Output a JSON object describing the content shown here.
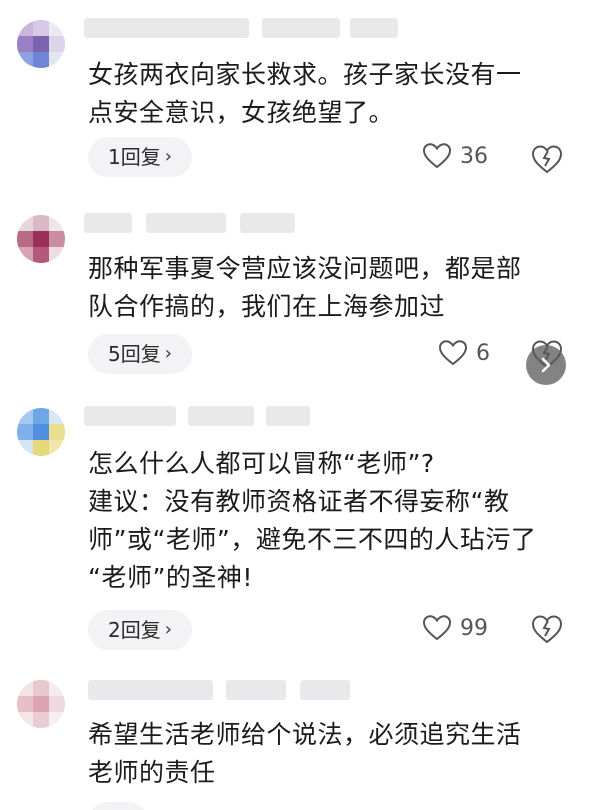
{
  "comments": [
    {
      "text": "女孩两衣向家长救求。孩子家长没有一\n点安全意识，女孩绝望了。",
      "reply_label": "1回复",
      "like_count": "36",
      "avatar_colors": [
        "#c9b6dc",
        "#d8c8e6",
        "#eceaf1",
        "#9a7fc4",
        "#7c63b0",
        "#dcd4ea",
        "#8ca2e0",
        "#6f86d6",
        "#e3e6f2"
      ]
    },
    {
      "text": "那种军事夏令营应该没问题吧，都是部\n队合作搞的，我们在上海参加过",
      "reply_label": "5回复",
      "like_count": "6",
      "avatar_colors": [
        "#e7d6dc",
        "#d9b9c4",
        "#efe6ea",
        "#b86a86",
        "#9b2f57",
        "#c98ea2",
        "#d6a4b4",
        "#b35a78",
        "#eddde3"
      ]
    },
    {
      "text": "怎么什么人都可以冒称“老师”?\n建议：没有教师资格证者不得妄称“教\n师”或“老师”，避免不三不四的人玷污了\n“老师”的圣神!",
      "reply_label": "2回复",
      "like_count": "99",
      "avatar_colors": [
        "#a9c8ef",
        "#6fa6e6",
        "#d8e6f5",
        "#7fb0ea",
        "#4f8ee0",
        "#e9de8e",
        "#d6e3f3",
        "#e5d77a",
        "#f0e7a9"
      ]
    },
    {
      "text": "希望生活老师给个说法，必须追究生活\n老师的责任",
      "reply_label": "",
      "like_count": "",
      "avatar_colors": [
        "#f1e3e6",
        "#e8c8cf",
        "#f4ecee",
        "#e7bfc9",
        "#dca3b2",
        "#efd8de",
        "#f2e6e8",
        "#e9ccd4",
        "#f6eef0"
      ]
    }
  ]
}
